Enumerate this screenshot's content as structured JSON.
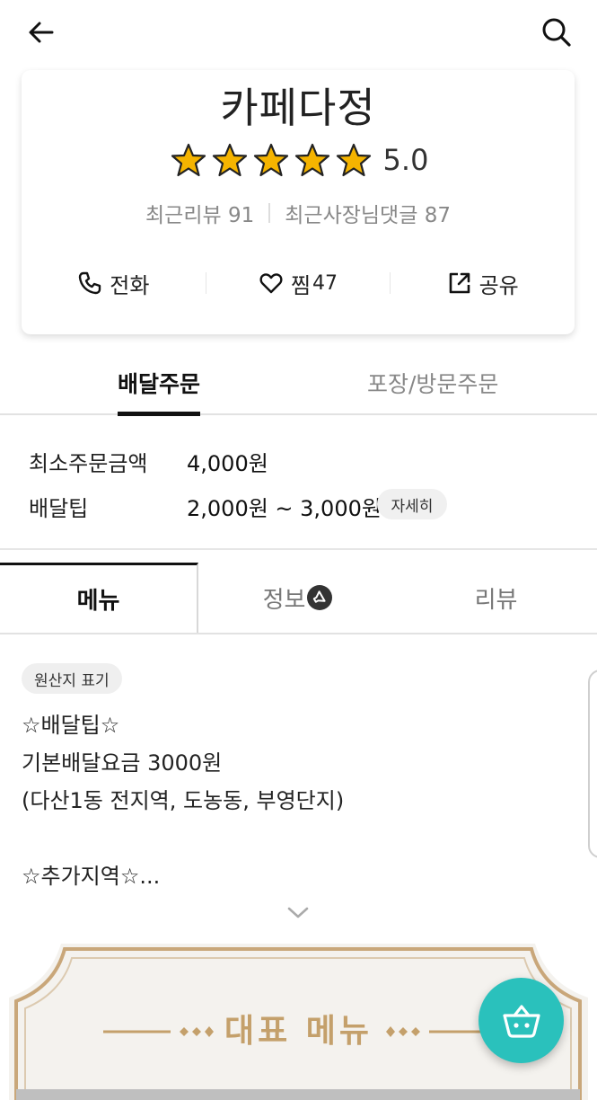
{
  "store": {
    "name": "카페다정",
    "rating": "5.0",
    "stars_filled": 5,
    "stars_total": 5,
    "recent_reviews_label": "최근리뷰",
    "recent_reviews_count": "91",
    "owner_replies_label": "최근사장님댓글",
    "owner_replies_count": "87"
  },
  "actions": {
    "call_label": "전화",
    "like_label": "찜",
    "like_count": "47",
    "share_label": "공유"
  },
  "order_tabs": {
    "delivery": "배달주문",
    "pickup": "포장/방문주문"
  },
  "order_info": {
    "min_order_label": "최소주문금액",
    "min_order_value": "4,000원",
    "delivery_tip_label": "배달팁",
    "delivery_tip_value": "2,000원 ~ 3,000원",
    "detail_button": "자세히"
  },
  "main_tabs": {
    "menu": "메뉴",
    "info": "정보",
    "review": "리뷰"
  },
  "notice": {
    "origin_chip": "원산지 표기",
    "lines": [
      "☆배달팁☆",
      "기본배달요금 3000원",
      "(다산1동 전지역, 도농동, 부영단지)",
      "",
      "☆추가지역☆..."
    ]
  },
  "banner": {
    "title": "대표 메뉴"
  },
  "colors": {
    "accent": "#2ac1bc",
    "star": "#f5b400",
    "gold": "#c4a06b"
  },
  "icons": {
    "back": "arrow-left-icon",
    "search": "search-icon",
    "call": "phone-icon",
    "like": "heart-icon",
    "share": "share-icon",
    "info_badge": "megaphone-icon",
    "expand": "chevron-down-icon",
    "cart": "basket-icon"
  }
}
